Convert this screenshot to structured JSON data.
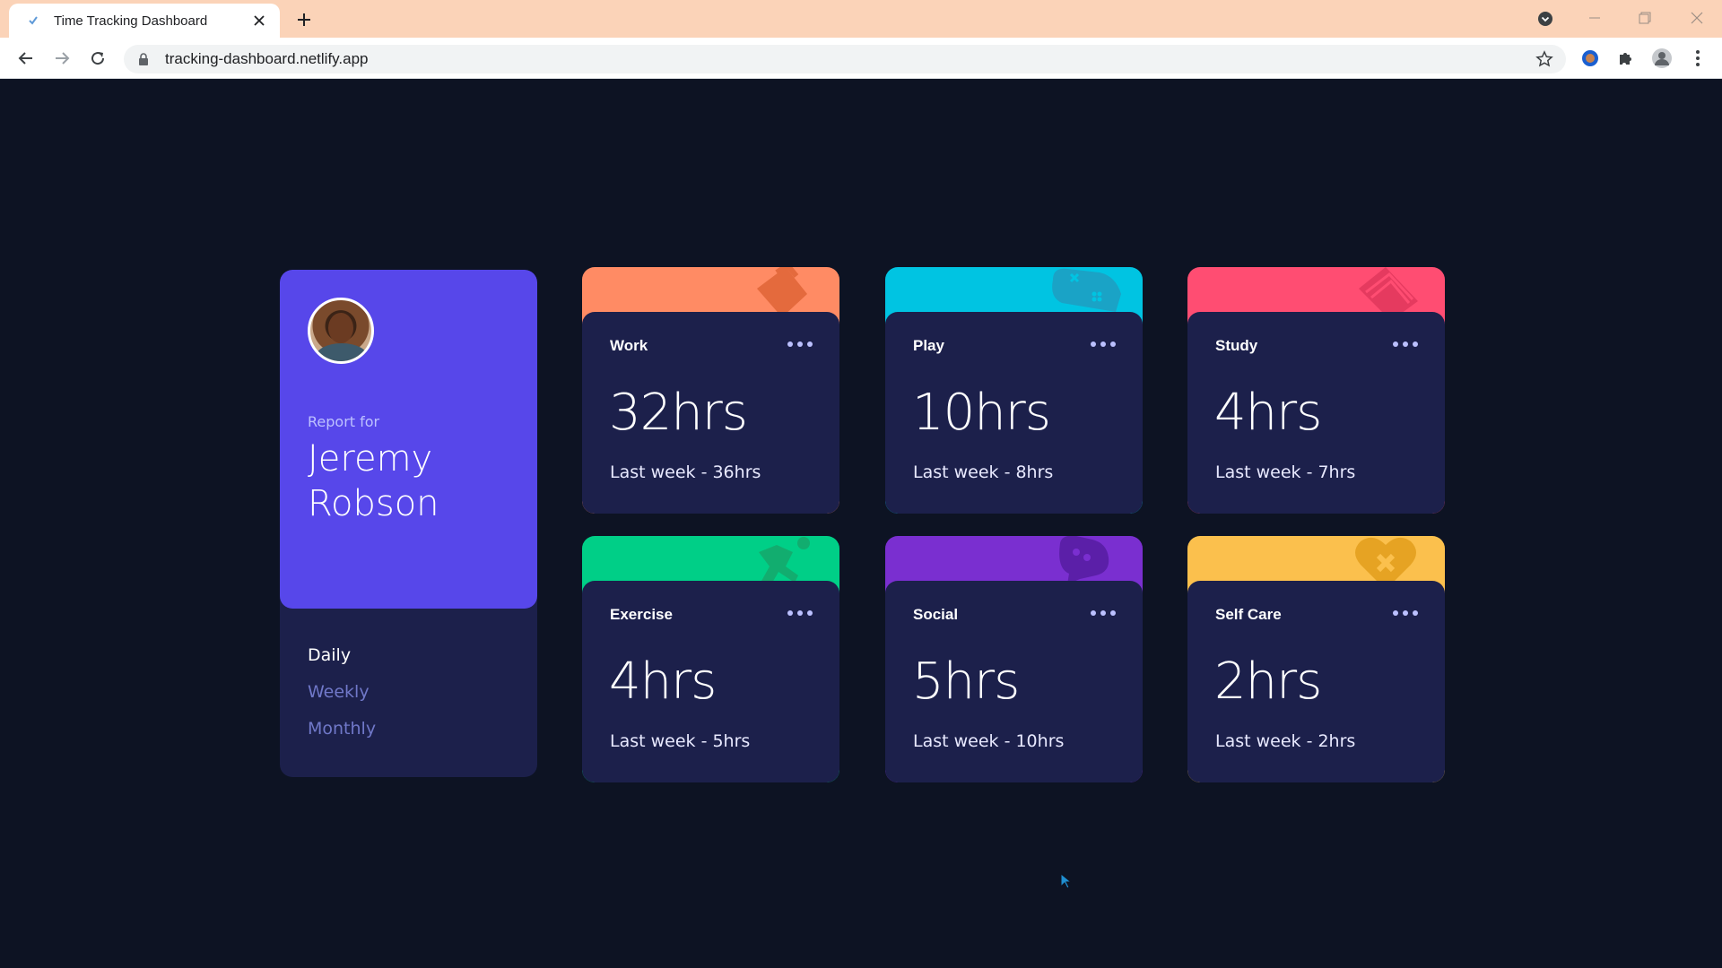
{
  "browser": {
    "tab_title": "Time Tracking Dashboard",
    "url": "tracking-dashboard.netlify.app",
    "tabbar_color": "#fbd3b8"
  },
  "profile": {
    "report_label": "Report for",
    "name": "Jeremy Robson",
    "periods": [
      {
        "label": "Daily",
        "active": true
      },
      {
        "label": "Weekly",
        "active": false
      },
      {
        "label": "Monthly",
        "active": false
      }
    ],
    "accent_color": "#5747ea"
  },
  "activities": [
    {
      "title": "Work",
      "current": "32hrs",
      "previous": "Last week - 36hrs",
      "color": "#ff8b64",
      "icon": "briefcase-icon"
    },
    {
      "title": "Play",
      "current": "10hrs",
      "previous": "Last week - 8hrs",
      "color": "#55c2e6",
      "icon": "gamepad-icon"
    },
    {
      "title": "Study",
      "current": "4hrs",
      "previous": "Last week - 7hrs",
      "color": "#ff5e7d",
      "icon": "book-icon"
    },
    {
      "title": "Exercise",
      "current": "4hrs",
      "previous": "Last week - 5hrs",
      "color": "#4bcf82",
      "icon": "runner-icon"
    },
    {
      "title": "Social",
      "current": "5hrs",
      "previous": "Last week - 10hrs",
      "color": "#7335d2",
      "icon": "chat-icon"
    },
    {
      "title": "Self Care",
      "current": "2hrs",
      "previous": "Last week - 2hrs",
      "color": "#f1c75b",
      "icon": "heart-bandage-icon"
    }
  ],
  "colors": {
    "background": "#0d1323",
    "card": "#1c204b",
    "muted_text": "#7078c9"
  }
}
